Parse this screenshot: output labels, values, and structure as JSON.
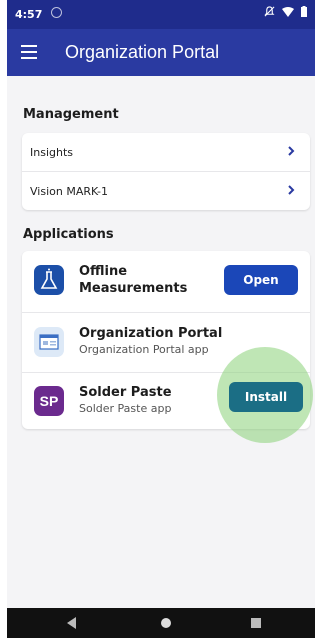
{
  "status_bar": {
    "time": "4:57"
  },
  "app_bar": {
    "title": "Organization Portal"
  },
  "management": {
    "title": "Management",
    "items": [
      {
        "label": "Insights"
      },
      {
        "label": "Vision MARK-1"
      }
    ]
  },
  "applications": {
    "title": "Applications",
    "items": [
      {
        "name": "Offline\nMeasurements",
        "subtitle": "",
        "button": "Open",
        "icon": "beaker-icon"
      },
      {
        "name": "Organization Portal",
        "subtitle": "Organization Portal app",
        "button": "",
        "icon": "portal-window-icon"
      },
      {
        "name": "Solder Paste",
        "subtitle": "Solder Paste app",
        "button": "Install",
        "icon_text": "SP",
        "icon": "sp-icon"
      }
    ]
  },
  "colors": {
    "appbar": "#2a3aa1",
    "statusbar": "#1f2c8c",
    "open_button": "#1b47b8",
    "install_button": "#1b6e85"
  }
}
